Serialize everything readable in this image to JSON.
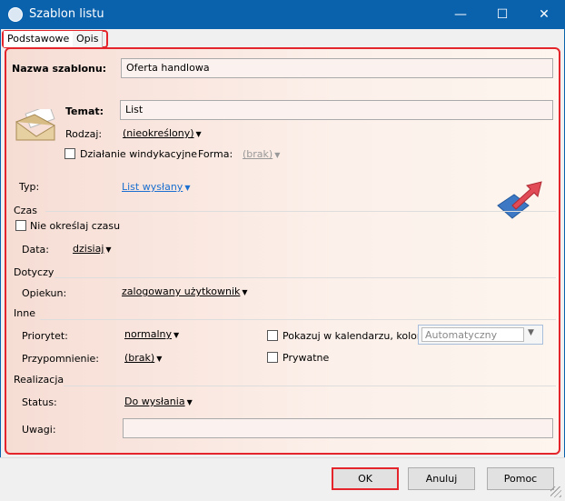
{
  "window": {
    "title": "Szablon listu",
    "minimize": "—",
    "maximize": "☐",
    "close": "✕"
  },
  "tabs": [
    {
      "label": "Podstawowe"
    },
    {
      "label": "Opis"
    }
  ],
  "form": {
    "name_label": "Nazwa szablonu:",
    "name_value": "Oferta handlowa",
    "subject_label": "Temat:",
    "subject_value": "List",
    "kind_label": "Rodzaj:",
    "kind_value": "(nieokreślony)",
    "collection_label": "Działanie windykacyjne",
    "form_label": "Forma:",
    "form_value": "(brak)",
    "type_label": "Typ:",
    "type_value": "List wysłany",
    "time_section": "Czas",
    "no_time_label": "Nie określaj czasu",
    "date_label": "Data:",
    "date_value": "dzisiaj",
    "concerns_section": "Dotyczy",
    "owner_label": "Opiekun:",
    "owner_value": "zalogowany użytkownik",
    "other_section": "Inne",
    "priority_label": "Priorytet:",
    "priority_value": "normalny",
    "reminder_label": "Przypomnienie:",
    "reminder_value": "(brak)",
    "calendar_label": "Pokazuj w kalendarzu, kolor:",
    "color_value": "Automatyczny",
    "private_label": "Prywatne",
    "realization_section": "Realizacja",
    "status_label": "Status:",
    "status_value": "Do wysłania",
    "notes_label": "Uwagi:",
    "notes_value": ""
  },
  "buttons": {
    "ok": "OK",
    "cancel": "Anuluj",
    "help": "Pomoc"
  }
}
